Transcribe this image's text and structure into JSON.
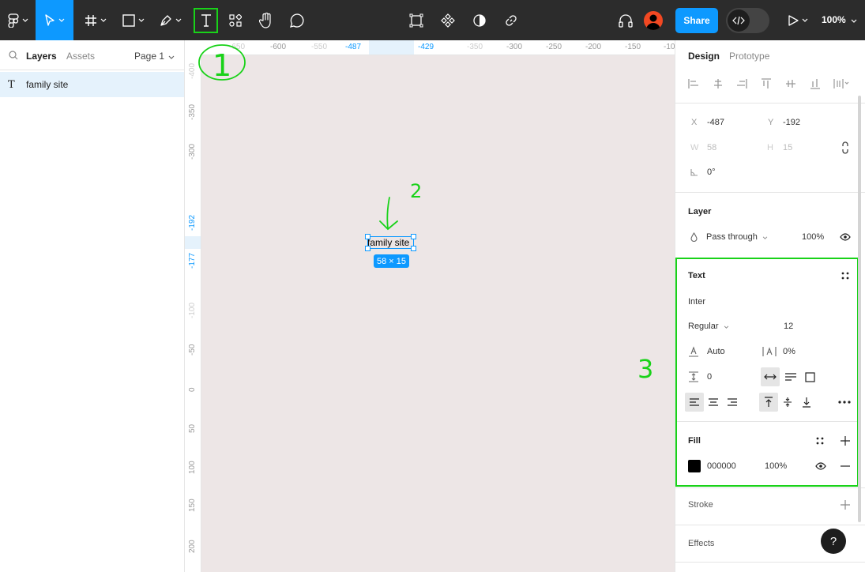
{
  "toolbar": {
    "share_label": "Share",
    "zoom": "100%",
    "icons": [
      "figma-menu-icon",
      "move-tool-icon",
      "frame-tool-icon",
      "shape-tool-icon",
      "pen-tool-icon",
      "text-tool-icon",
      "resources-icon",
      "hand-tool-icon",
      "comment-icon",
      "component-icon",
      "variants-icon",
      "contrast-icon",
      "link-icon",
      "headphones-icon",
      "avatar",
      "dev-mode-icon",
      "present-icon"
    ]
  },
  "left_panel": {
    "tabs": {
      "layers": "Layers",
      "assets": "Assets"
    },
    "page": "Page 1",
    "layers": [
      {
        "icon": "T",
        "name": "family site"
      }
    ]
  },
  "ruler_top": {
    "labels": [
      "-650",
      "-600",
      "-550",
      "-487",
      "-429",
      "-350",
      "-300",
      "-250",
      "-200",
      "-150",
      "-10"
    ]
  },
  "ruler_left": {
    "labels": [
      "-400",
      "-350",
      "-300",
      "-192",
      "-177",
      "-100",
      "-50",
      "0",
      "50",
      "100",
      "150",
      "200"
    ]
  },
  "canvas": {
    "text": "family site",
    "dimensions": "58 × 15"
  },
  "annotations": {
    "one": "1",
    "two": "2",
    "three": "3"
  },
  "right_panel": {
    "tabs": {
      "design": "Design",
      "prototype": "Prototype"
    },
    "position": {
      "x_label": "X",
      "x": "-487",
      "y_label": "Y",
      "y": "-192"
    },
    "size": {
      "w_label": "W",
      "w": "58",
      "h_label": "H",
      "h": "15"
    },
    "rotation": "0°",
    "layer": {
      "title": "Layer",
      "blend": "Pass through",
      "opacity": "100%"
    },
    "text": {
      "title": "Text",
      "font": "Inter",
      "weight": "Regular",
      "size": "12",
      "line_height": "Auto",
      "letter_spacing": "0%",
      "paragraph_spacing": "0"
    },
    "fill": {
      "title": "Fill",
      "hex": "000000",
      "opacity": "100%"
    },
    "stroke": {
      "title": "Stroke"
    },
    "effects": {
      "title": "Effects"
    },
    "help": "?"
  },
  "colors": {
    "accent": "#0d99ff",
    "toolbar_bg": "#2c2c2c",
    "canvas_bg": "#ede6e6",
    "annotation": "#19d219",
    "avatar": "#f24822"
  }
}
